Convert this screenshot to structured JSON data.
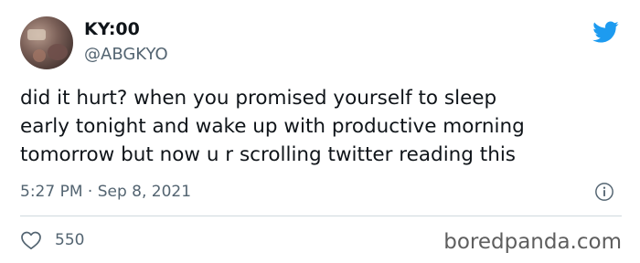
{
  "author": {
    "name": "KY:00",
    "handle": "@ABGKYO"
  },
  "tweet": {
    "text": "did it hurt? when you promised yourself to sleep\nearly tonight and wake up with productive morning\ntomorrow but now u r scrolling twitter reading this",
    "timestamp": "5:27 PM · Sep 8, 2021"
  },
  "engagement": {
    "likes": "550"
  },
  "watermark": "boredpanda.com",
  "icons": {
    "brand": "twitter-bird-icon",
    "info": "info-icon",
    "like": "heart-icon"
  },
  "colors": {
    "twitter_blue": "#1d9bf0",
    "secondary_text": "#536471",
    "primary_text": "#0f1419"
  }
}
